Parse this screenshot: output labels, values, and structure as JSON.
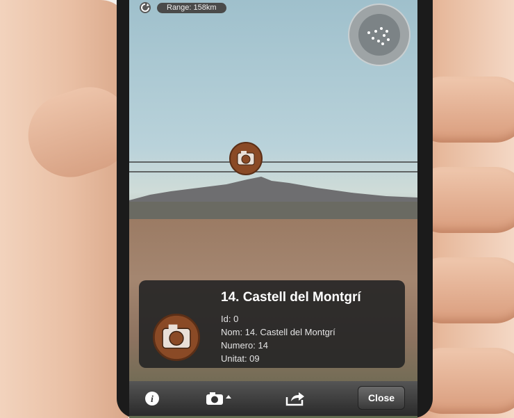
{
  "status": {
    "range_label": "Range: 158km"
  },
  "poi": {
    "title": "14. Castell del Montgrí",
    "details": [
      "Id: 0",
      "Nom: 14. Castell del Montgrí",
      "Numero: 14",
      "Unitat: 09"
    ]
  },
  "toolbar": {
    "close_label": "Close"
  },
  "icons": [
    "refresh-icon",
    "radar-icon",
    "camera-icon",
    "info-icon",
    "share-icon"
  ],
  "colors": {
    "panel": "#262626",
    "marker_wood": "#8a4a26",
    "toolbar": "#2a2a2a"
  }
}
